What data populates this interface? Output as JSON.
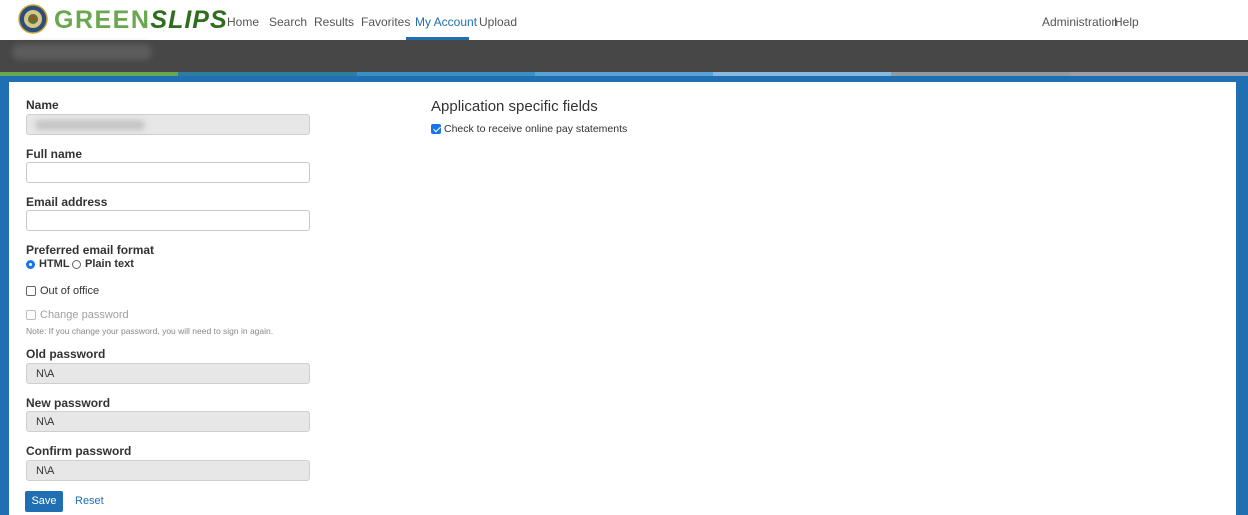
{
  "brand": {
    "part1": "GREEN",
    "part2": "SLIPS"
  },
  "nav": {
    "home": "Home",
    "search": "Search",
    "results": "Results",
    "favorites": "Favorites",
    "my_account": "My Account",
    "upload": "Upload",
    "administration": "Administration",
    "help": "Help"
  },
  "colors": {
    "accent": "#1f6fb2",
    "strip": [
      "#6aa84f",
      "#2e7d9e",
      "#3a8fc4",
      "#5aa3d6",
      "#8ab9de",
      "#8f9aa3",
      "#9aa0a6"
    ]
  },
  "form": {
    "name_label": "Name",
    "full_name_label": "Full name",
    "email_label": "Email address",
    "email_format_label": "Preferred email format",
    "format_options": {
      "html": "HTML",
      "plain": "Plain text",
      "selected": "HTML"
    },
    "out_of_office": "Out of office",
    "change_password": "Change password",
    "note": "Note: If you change your password, you will need to sign in again.",
    "old_password_label": "Old password",
    "old_password_value": "N\\A",
    "new_password_label": "New password",
    "new_password_value": "N\\A",
    "confirm_password_label": "Confirm password",
    "confirm_password_value": "N\\A",
    "save": "Save",
    "reset": "Reset"
  },
  "app_fields": {
    "title": "Application specific fields",
    "pay_statements": "Check to receive online pay statements",
    "pay_statements_checked": true
  },
  "icons": [
    "seal-icon",
    "checkbox-checked-icon"
  ]
}
